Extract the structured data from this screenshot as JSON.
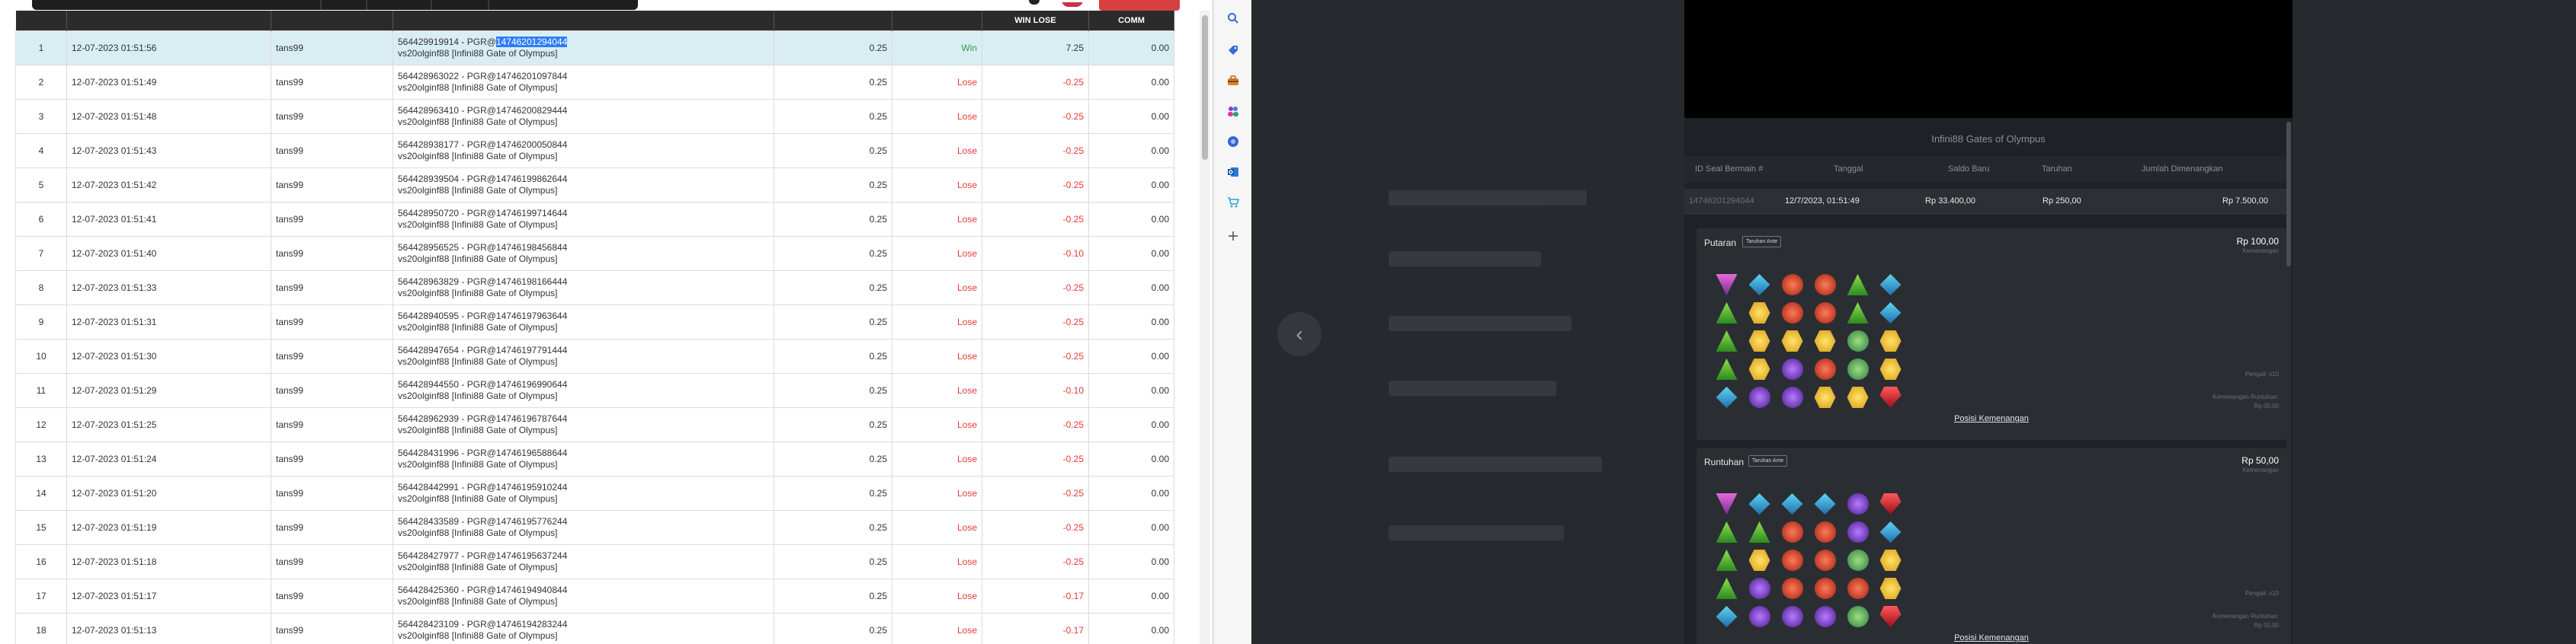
{
  "table": {
    "columns": [
      "",
      "",
      "",
      "",
      "",
      "",
      "WIN LOSE",
      "COMM"
    ],
    "rows": [
      {
        "no": "1",
        "date": "12-07-2023 01:51:56",
        "user": "tans99",
        "id_pre": "564429919914 - PGR@",
        "id_hl": "14746201294044",
        "id_post": "",
        "title": "vs20olginf88 [Infini88 Gate of Olympus]",
        "bet": "0.25",
        "result": "Win",
        "winlose": "7.25",
        "comm": "0.00"
      },
      {
        "no": "2",
        "date": "12-07-2023 01:51:49",
        "user": "tans99",
        "id_pre": "564428963022 - PGR@14746201097844",
        "id_hl": "",
        "id_post": "",
        "title": "vs20olginf88 [Infini88 Gate of Olympus]",
        "bet": "0.25",
        "result": "Lose",
        "winlose": "-0.25",
        "comm": "0.00"
      },
      {
        "no": "3",
        "date": "12-07-2023 01:51:48",
        "user": "tans99",
        "id_pre": "564428963410 - PGR@14746200829444",
        "id_hl": "",
        "id_post": "",
        "title": "vs20olginf88 [Infini88 Gate of Olympus]",
        "bet": "0.25",
        "result": "Lose",
        "winlose": "-0.25",
        "comm": "0.00"
      },
      {
        "no": "4",
        "date": "12-07-2023 01:51:43",
        "user": "tans99",
        "id_pre": "564428938177 - PGR@14746200050844",
        "id_hl": "",
        "id_post": "",
        "title": "vs20olginf88 [Infini88 Gate of Olympus]",
        "bet": "0.25",
        "result": "Lose",
        "winlose": "-0.25",
        "comm": "0.00"
      },
      {
        "no": "5",
        "date": "12-07-2023 01:51:42",
        "user": "tans99",
        "id_pre": "564428939504 - PGR@14746199862644",
        "id_hl": "",
        "id_post": "",
        "title": "vs20olginf88 [Infini88 Gate of Olympus]",
        "bet": "0.25",
        "result": "Lose",
        "winlose": "-0.25",
        "comm": "0.00"
      },
      {
        "no": "6",
        "date": "12-07-2023 01:51:41",
        "user": "tans99",
        "id_pre": "564428950720 - PGR@14746199714644",
        "id_hl": "",
        "id_post": "",
        "title": "vs20olginf88 [Infini88 Gate of Olympus]",
        "bet": "0.25",
        "result": "Lose",
        "winlose": "-0.25",
        "comm": "0.00"
      },
      {
        "no": "7",
        "date": "12-07-2023 01:51:40",
        "user": "tans99",
        "id_pre": "564428956525 - PGR@14746198456844",
        "id_hl": "",
        "id_post": "",
        "title": "vs20olginf88 [Infini88 Gate of Olympus]",
        "bet": "0.25",
        "result": "Lose",
        "winlose": "-0.10",
        "comm": "0.00"
      },
      {
        "no": "8",
        "date": "12-07-2023 01:51:33",
        "user": "tans99",
        "id_pre": "564428963829 - PGR@14746198166444",
        "id_hl": "",
        "id_post": "",
        "title": "vs20olginf88 [Infini88 Gate of Olympus]",
        "bet": "0.25",
        "result": "Lose",
        "winlose": "-0.25",
        "comm": "0.00"
      },
      {
        "no": "9",
        "date": "12-07-2023 01:51:31",
        "user": "tans99",
        "id_pre": "564428940595 - PGR@14746197963644",
        "id_hl": "",
        "id_post": "",
        "title": "vs20olginf88 [Infini88 Gate of Olympus]",
        "bet": "0.25",
        "result": "Lose",
        "winlose": "-0.25",
        "comm": "0.00"
      },
      {
        "no": "10",
        "date": "12-07-2023 01:51:30",
        "user": "tans99",
        "id_pre": "564428947654 - PGR@14746197791444",
        "id_hl": "",
        "id_post": "",
        "title": "vs20olginf88 [Infini88 Gate of Olympus]",
        "bet": "0.25",
        "result": "Lose",
        "winlose": "-0.25",
        "comm": "0.00"
      },
      {
        "no": "11",
        "date": "12-07-2023 01:51:29",
        "user": "tans99",
        "id_pre": "564428944550 - PGR@14746196990644",
        "id_hl": "",
        "id_post": "",
        "title": "vs20olginf88 [Infini88 Gate of Olympus]",
        "bet": "0.25",
        "result": "Lose",
        "winlose": "-0.10",
        "comm": "0.00"
      },
      {
        "no": "12",
        "date": "12-07-2023 01:51:25",
        "user": "tans99",
        "id_pre": "564428962939 - PGR@14746196787644",
        "id_hl": "",
        "id_post": "",
        "title": "vs20olginf88 [Infini88 Gate of Olympus]",
        "bet": "0.25",
        "result": "Lose",
        "winlose": "-0.25",
        "comm": "0.00"
      },
      {
        "no": "13",
        "date": "12-07-2023 01:51:24",
        "user": "tans99",
        "id_pre": "564428431996 - PGR@14746196588644",
        "id_hl": "",
        "id_post": "",
        "title": "vs20olginf88 [Infini88 Gate of Olympus]",
        "bet": "0.25",
        "result": "Lose",
        "winlose": "-0.25",
        "comm": "0.00"
      },
      {
        "no": "14",
        "date": "12-07-2023 01:51:20",
        "user": "tans99",
        "id_pre": "564428442991 - PGR@14746195910244",
        "id_hl": "",
        "id_post": "",
        "title": "vs20olginf88 [Infini88 Gate of Olympus]",
        "bet": "0.25",
        "result": "Lose",
        "winlose": "-0.25",
        "comm": "0.00"
      },
      {
        "no": "15",
        "date": "12-07-2023 01:51:19",
        "user": "tans99",
        "id_pre": "564428433589 - PGR@14746195776244",
        "id_hl": "",
        "id_post": "",
        "title": "vs20olginf88 [Infini88 Gate of Olympus]",
        "bet": "0.25",
        "result": "Lose",
        "winlose": "-0.25",
        "comm": "0.00"
      },
      {
        "no": "16",
        "date": "12-07-2023 01:51:18",
        "user": "tans99",
        "id_pre": "564428427977 - PGR@14746195637244",
        "id_hl": "",
        "id_post": "",
        "title": "vs20olginf88 [Infini88 Gate of Olympus]",
        "bet": "0.25",
        "result": "Lose",
        "winlose": "-0.25",
        "comm": "0.00"
      },
      {
        "no": "17",
        "date": "12-07-2023 01:51:17",
        "user": "tans99",
        "id_pre": "564428425360 - PGR@14746194940844",
        "id_hl": "",
        "id_post": "",
        "title": "vs20olginf88 [Infini88 Gate of Olympus]",
        "bet": "0.25",
        "result": "Lose",
        "winlose": "-0.17",
        "comm": "0.00"
      },
      {
        "no": "18",
        "date": "12-07-2023 01:51:13",
        "user": "tans99",
        "id_pre": "564428423109 - PGR@14746194283244",
        "id_hl": "",
        "id_post": "",
        "title": "vs20olginf88 [Infini88 Gate of Olympus]",
        "bet": "0.25",
        "result": "Lose",
        "winlose": "-0.17",
        "comm": "0.00"
      }
    ]
  },
  "sidebar_icons": [
    "search-icon",
    "tag-icon",
    "briefcase-icon",
    "people-icon",
    "copilot-icon",
    "outlook-icon",
    "cart-icon",
    "plus-icon"
  ],
  "game": {
    "title": "Infini88 Gates of Olympus",
    "summary_headers": [
      "ID Seal Bermain #",
      "Tanggal",
      "Saldo Baru",
      "Taruhan",
      "Jumlah Dimenangkan"
    ],
    "summary_values": [
      "14746201294044",
      "12/7/2023, 01:51:49",
      "Rp 33.400,00",
      "Rp 250,00",
      "Rp 7.500,00"
    ],
    "spins": [
      {
        "label": "Putaran",
        "badge": "Taruhan Ante",
        "amount": "Rp 100,00",
        "amount_sub": "Kemenangan",
        "meta1": "Pengali: x10",
        "meta2": "Kemenangan Runtuhan:",
        "meta3": "Rp 00,00",
        "link": "Posisi Kemenangan"
      },
      {
        "label": "Runtuhan",
        "badge": "Taruhan Ante",
        "amount": "Rp 50,00",
        "amount_sub": "Kemenangan",
        "meta1": "Pengali: x10",
        "meta2": "Kemenangan Runtuhan:",
        "meta3": "Rp 50,00",
        "link": "Posisi Kemenangan"
      }
    ],
    "grids": [
      [
        "tri-down",
        "diam",
        "round-r",
        "round-r",
        "tri",
        "diam",
        "tri",
        "hex",
        "round-r",
        "round-r",
        "tri",
        "diam",
        "tri",
        "hex",
        "hex",
        "hex",
        "ball-g",
        "hex",
        "tri",
        "hex",
        "round-p",
        "round-r",
        "ball-g",
        "hex",
        "diam",
        "round-p",
        "round-p",
        "hex",
        "hex",
        "ruby"
      ],
      [
        "tri-down",
        "diam",
        "diam",
        "diam",
        "round-p",
        "ruby",
        "tri",
        "tri",
        "round-r",
        "round-r",
        "round-p",
        "diam",
        "tri",
        "hex",
        "round-r",
        "round-r",
        "ball-g",
        "hex",
        "tri",
        "round-p",
        "round-r",
        "round-r",
        "round-r",
        "hex",
        "diam",
        "round-p",
        "round-p",
        "round-p",
        "ball-g",
        "ruby"
      ]
    ]
  }
}
